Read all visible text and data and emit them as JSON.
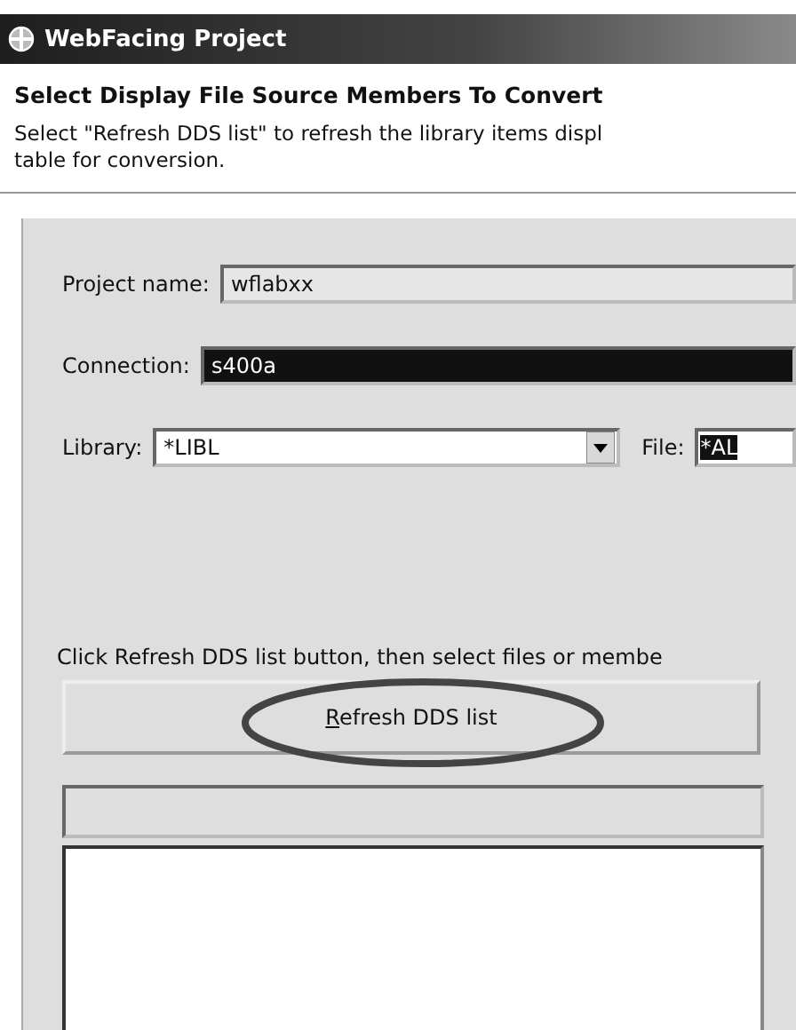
{
  "window": {
    "title": "WebFacing Project"
  },
  "header": {
    "title": "Select Display File Source Members To Convert",
    "description_lines": [
      "Select \"Refresh DDS list\" to refresh the library items displ",
      "table for conversion."
    ]
  },
  "project_name": {
    "label": "Project name:",
    "value": "wflabxx",
    "readonly": true
  },
  "connection": {
    "label": "Connection:",
    "value": "s400a",
    "highlighted": true
  },
  "library": {
    "label": "Library:",
    "value": "*LIBL",
    "highlighted": false
  },
  "file": {
    "label": "File:",
    "value": "*AL",
    "highlighted": true
  },
  "instruction": "Click Refresh DDS list button, then select files or membe",
  "refresh_button": {
    "label": "Refresh DDS list",
    "circled": true
  }
}
